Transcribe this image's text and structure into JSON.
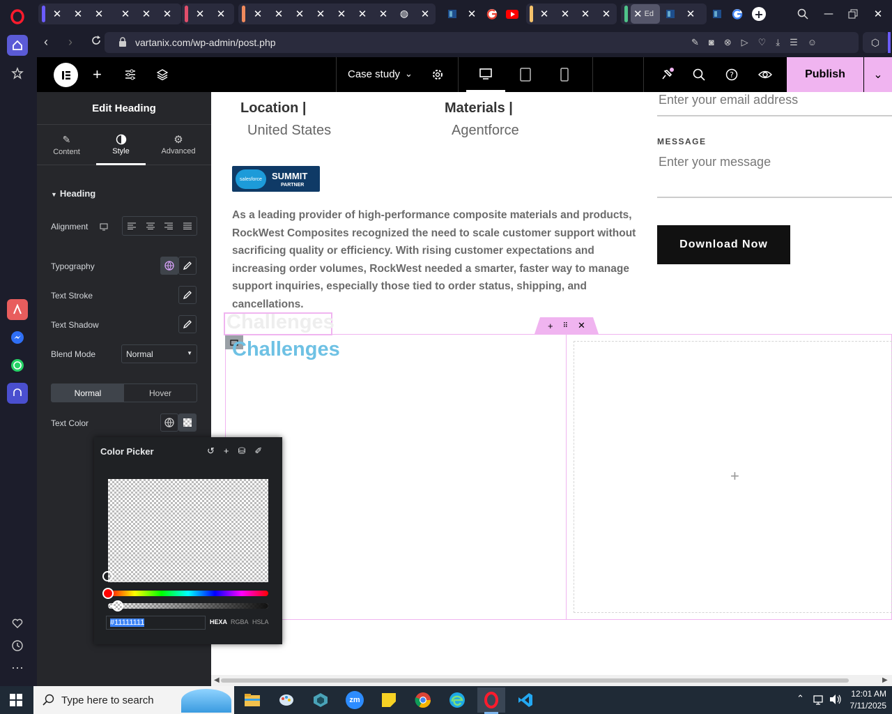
{
  "browser": {
    "url": "vartanix.com/wp-admin/post.php",
    "active_tab_label": "Ed"
  },
  "elementor": {
    "page_title": "Case study",
    "publish_label": "Publish"
  },
  "panel": {
    "title": "Edit Heading",
    "tabs": [
      {
        "label": "Content"
      },
      {
        "label": "Style"
      },
      {
        "label": "Advanced"
      }
    ],
    "section_title": "Heading",
    "alignment_label": "Alignment",
    "typography_label": "Typography",
    "text_stroke_label": "Text Stroke",
    "text_shadow_label": "Text Shadow",
    "blend_mode_label": "Blend Mode",
    "blend_mode_value": "Normal",
    "state_tabs": [
      "Normal",
      "Hover"
    ],
    "text_color_label": "Text Color"
  },
  "color_picker": {
    "title": "Color Picker",
    "hex_value": "#11111111",
    "modes": [
      "HEXA",
      "RGBA",
      "HSLA"
    ]
  },
  "canvas": {
    "location_label": "Location |",
    "location_value": "United States",
    "materials_label": "Materials |",
    "materials_value": "Agentforce",
    "badge_brand": "salesforce",
    "badge_line1": "SUMMIT",
    "badge_line2": "PARTNER",
    "body_text": "As a leading provider of high-performance composite materials and products, RockWest Composites recognized the need to scale customer support without sacrificing quality or efficiency. With rising customer expectations and increasing order volumes, RockWest needed a smarter, faster way to manage support inquiries, especially those tied to order status, shipping, and cancellations.",
    "email_placeholder": "Enter your email address",
    "message_label": "MESSAGE",
    "message_placeholder": "Enter your message",
    "download_button": "Download Now",
    "heading_ghost": "Challenges",
    "heading": "Challenges",
    "heading_color": "#6ec1e4"
  },
  "taskbar": {
    "search_placeholder": "Type here to search",
    "time": "12:01 AM",
    "date": "7/11/2025"
  },
  "colors": {
    "publish_bg": "#f0b4f0",
    "opera_red": "#ff1b2d",
    "button_dark": "#111111"
  }
}
